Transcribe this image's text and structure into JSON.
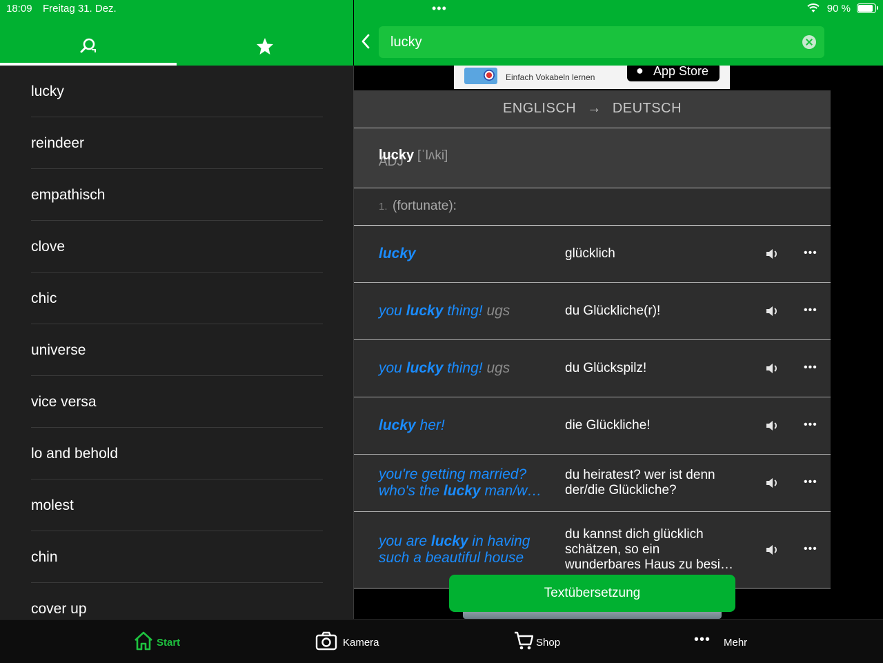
{
  "status": {
    "time": "18:09",
    "date": "Freitag 31. Dez.",
    "battery": "90 %"
  },
  "colors": {
    "brand_green": "#01b131",
    "link_blue": "#1a8cff"
  },
  "history": [
    "lucky",
    "reindeer",
    "empathisch",
    "clove",
    "chic",
    "universe",
    "vice versa",
    "lo and behold",
    "molest",
    "chin",
    "cover up"
  ],
  "search": {
    "query": "lucky"
  },
  "ad": {
    "text": "Einfach Vokabeln lernen",
    "store": "App Store"
  },
  "dictionary": {
    "direction_from": "ENGLISCH",
    "arrow": "→",
    "direction_to": "DEUTSCH",
    "headword": "lucky",
    "pos": "ADJ",
    "ipa": "[ˈlʌki]",
    "sense_num": "1.",
    "sense": "(fortunate):",
    "entries": [
      {
        "parts": [
          {
            "t": "lucky",
            "b": true
          }
        ],
        "dst": "glücklich"
      },
      {
        "parts": [
          {
            "t": "you "
          },
          {
            "t": "lucky",
            "b": true
          },
          {
            "t": " thing! "
          },
          {
            "t": "ugs",
            "g": true
          }
        ],
        "dst": "du Glückliche(r)!"
      },
      {
        "parts": [
          {
            "t": "you "
          },
          {
            "t": "lucky",
            "b": true
          },
          {
            "t": " thing! "
          },
          {
            "t": "ugs",
            "g": true
          }
        ],
        "dst": "du Glückspilz!"
      },
      {
        "parts": [
          {
            "t": "lucky",
            "b": true
          },
          {
            "t": " her!"
          }
        ],
        "dst": "die Glückliche!"
      },
      {
        "parts": [
          {
            "t": "you're getting married?"
          },
          {
            "br": true
          },
          {
            "t": "who's the "
          },
          {
            "t": "lucky",
            "b": true
          },
          {
            "t": " man/w…"
          }
        ],
        "dst_lines": [
          "du heiratest? wer ist denn",
          "der/die Glückliche?"
        ]
      },
      {
        "parts": [
          {
            "t": "you are "
          },
          {
            "t": "lucky",
            "b": true
          },
          {
            "t": " in having"
          },
          {
            "br": true
          },
          {
            "t": "such a beautiful house"
          }
        ],
        "dst_lines": [
          "du kannst dich glücklich",
          "schätzen, so ein",
          "wunderbares Haus zu besi…"
        ]
      }
    ],
    "more_label": "•••"
  },
  "cta": "Textübersetzung",
  "nav": {
    "start": "Start",
    "camera": "Kamera",
    "shop": "Shop",
    "more": "Mehr"
  }
}
